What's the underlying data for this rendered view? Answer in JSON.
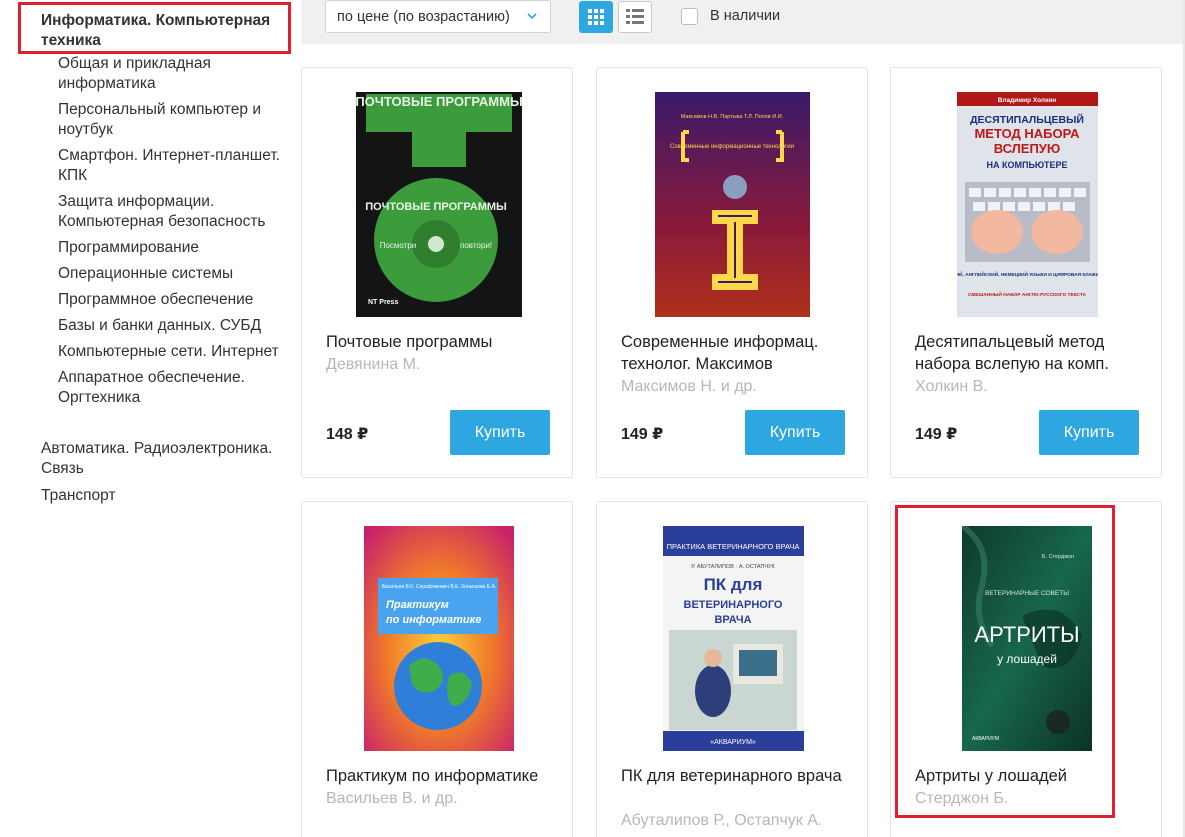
{
  "sidebar": {
    "active_category": "Информатика. Компьютерная техника",
    "sub_items": [
      "Общая и прикладная информатика",
      "Персональный компьютер и ноутбук",
      "Смартфон. Интернет-планшет. КПК",
      "Защита информации. Компьютерная безопасность",
      "Программирование",
      "Операционные системы",
      "Программное обеспечение",
      "Базы и банки данных. СУБД",
      "Компьютерные сети. Интернет",
      "Аппаратное обеспечение. Оргтехника"
    ],
    "top_items": [
      "Автоматика. Радиоэлектроника. Связь",
      "Транспорт"
    ]
  },
  "toolbar": {
    "sort_value": "по цене (по возрастанию)",
    "in_stock_label": "В наличии"
  },
  "products": [
    {
      "title": "Почтовые программы",
      "author": "Девянина М.",
      "price": "148 ₽",
      "buy": "Купить",
      "cover": {
        "top": "ПОЧТОВЫЕ ПРОГРАММЫ",
        "disc_title": "ПОЧТОВЫЕ ПРОГРАММЫ",
        "disc_left": "Посмотри",
        "disc_right": "повтори!",
        "publisher": "NT Press"
      }
    },
    {
      "title": "Современные информац. технолог. Максимов",
      "author": "Максимов Н. и др.",
      "price": "149 ₽",
      "buy": "Купить",
      "cover": {
        "authors": "Максимов Н.В. Партыка Т.Л. Попов И.И.",
        "title": "Современные информационные технологии"
      }
    },
    {
      "title": "Десятипальцевый метод набора вслепую на комп.",
      "author": "Холкин В.",
      "price": "149 ₽",
      "buy": "Купить",
      "cover": {
        "author": "Владимир Холкин",
        "pre": "ДЕСЯТИПАЛЬЦЕВЫЙ",
        "main1": "МЕТОД НАБОРА",
        "main2": "ВСЛЕПУЮ",
        "sub": "НА КОМПЬЮТЕРЕ",
        "bottom1": "РУССКИЙ, АНГЛИЙСКИЙ, НЕМЕЦКИЙ ЯЗЫКИ И ЦИФРОВАЯ КЛАВИАТУРА",
        "bottom2": "СМЕШАННЫЙ НАБОР АНГЛО-РУССКОГО ТЕКСТА"
      }
    },
    {
      "title": "Практикум по информатике",
      "author": "Васильев В. и др.",
      "price": "",
      "buy": "",
      "cover": {
        "authors": "Васильев В.К. Серафимович В.Е. Конышева Е.А.",
        "title1": "Практикум",
        "title2": "по информатике"
      }
    },
    {
      "title": "ПК для ветеринарного врача",
      "author": "Абуталипов Р., Остапчук А.",
      "price": "",
      "buy": "",
      "cover": {
        "series": "ПРАКТИКА ВЕТЕРИНАРНОГО ВРАЧА",
        "authors": "Р. АБУТАЛИПОВ · А. ОСТАПЧУК",
        "t1": "ПК для",
        "t2": "ВЕТЕРИНАРНОГО",
        "t3": "ВРАЧА",
        "publisher": "«АКВАРИУМ»"
      }
    },
    {
      "title": "Артриты у лошадей",
      "author": "Стерджон Б.",
      "price": "",
      "buy": "",
      "cover": {
        "author": "Б. Стерджон",
        "series": "ВЕТЕРИНАРНЫЕ СОВЕТЫ",
        "t1": "АРТРИТЫ",
        "t2": "у лошадей",
        "publisher": "АКВАРИУМ"
      }
    }
  ]
}
